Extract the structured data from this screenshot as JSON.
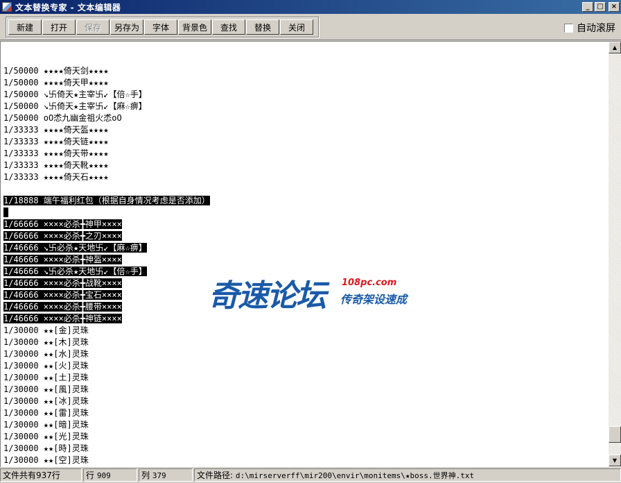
{
  "window": {
    "title": "文本替换专家 - 文本编辑器",
    "min_label": "_",
    "max_label": "□",
    "close_label": "×"
  },
  "toolbar": {
    "new_label": "新建",
    "open_label": "打开",
    "save_label": "保存",
    "save_as_label": "另存为",
    "font_label": "字体",
    "bg_color_label": "背景色",
    "find_label": "查找",
    "replace_label": "替换",
    "close_label": "关闭",
    "autoscroll_label": "自动滚屏",
    "autoscroll_checked": false
  },
  "editor": {
    "lines": [
      {
        "text": "1/50000 ★★★★倚天剑★★★★",
        "selected": false
      },
      {
        "text": "1/50000 ★★★★倚天甲★★★★",
        "selected": false
      },
      {
        "text": "1/50000 ↘卐倚天★主宰卐↙【倍☆手】",
        "selected": false
      },
      {
        "text": "1/50000 ↘卐倚天★主宰卐↙【麻☆痹】",
        "selected": false
      },
      {
        "text": "1/50000 oO怸九幽金祖火怸oO",
        "selected": false
      },
      {
        "text": "1/33333 ★★★★倚天盔★★★★",
        "selected": false
      },
      {
        "text": "1/33333 ★★★★倚天链★★★★",
        "selected": false
      },
      {
        "text": "1/33333 ★★★★倚天带★★★★",
        "selected": false
      },
      {
        "text": "1/33333 ★★★★倚天靴★★★★",
        "selected": false
      },
      {
        "text": "1/33333 ★★★★倚天石★★★★",
        "selected": false
      },
      {
        "text": "",
        "selected": false
      },
      {
        "text": "1/18888 端午福利红包（根据自身情况考虑是否添加）",
        "selected": true
      },
      {
        "text": " ",
        "selected": true
      },
      {
        "text": "1/66666 ××××必杀╋神甲××××",
        "selected": true
      },
      {
        "text": "1/66666 ××××必杀╋之刃××××",
        "selected": true
      },
      {
        "text": "1/46666 ↘卐必杀★天地卐↙【麻☆痹】",
        "selected": true
      },
      {
        "text": "1/46666 ××××必杀╋神盔××××",
        "selected": true
      },
      {
        "text": "1/46666 ↘卐必杀★天地卐↙【倍☆手】",
        "selected": true
      },
      {
        "text": "1/46666 ××××必杀╋战靴××××",
        "selected": true
      },
      {
        "text": "1/46666 ××××必杀╋宝石××××",
        "selected": true
      },
      {
        "text": "1/46666 ××××必杀╋腰带××××",
        "selected": true
      },
      {
        "text": "1/46666 ××××必杀╋神链××××",
        "selected": true
      },
      {
        "text": "1/30000 ★★[金]灵珠",
        "selected": false
      },
      {
        "text": "1/30000 ★★[木]灵珠",
        "selected": false
      },
      {
        "text": "1/30000 ★★[水]灵珠",
        "selected": false
      },
      {
        "text": "1/30000 ★★[火]灵珠",
        "selected": false
      },
      {
        "text": "1/30000 ★★[土]灵珠",
        "selected": false
      },
      {
        "text": "1/30000 ★★[風]灵珠",
        "selected": false
      },
      {
        "text": "1/30000 ★★[冰]灵珠",
        "selected": false
      },
      {
        "text": "1/30000 ★★[雷]灵珠",
        "selected": false
      },
      {
        "text": "1/30000 ★★[暗]灵珠",
        "selected": false
      },
      {
        "text": "1/30000 ★★[光]灵珠",
        "selected": false
      },
      {
        "text": "1/30000 ★★[時]灵珠",
        "selected": false
      },
      {
        "text": "1/30000 ★★[空]灵珠",
        "selected": false
      }
    ],
    "scroll_position": 0.97
  },
  "watermark": {
    "main": "奇速论坛",
    "site": "108pc.com",
    "sub": "传奇架设速成"
  },
  "statusbar": {
    "total_lines": "文件共有937行",
    "row_label": "行",
    "row_value": "909",
    "col_label": "列",
    "col_value": "379",
    "path_label": "文件路径:",
    "path_value": "d:\\mirserverff\\mir200\\envir\\monitems\\★boss.世界神.txt"
  }
}
